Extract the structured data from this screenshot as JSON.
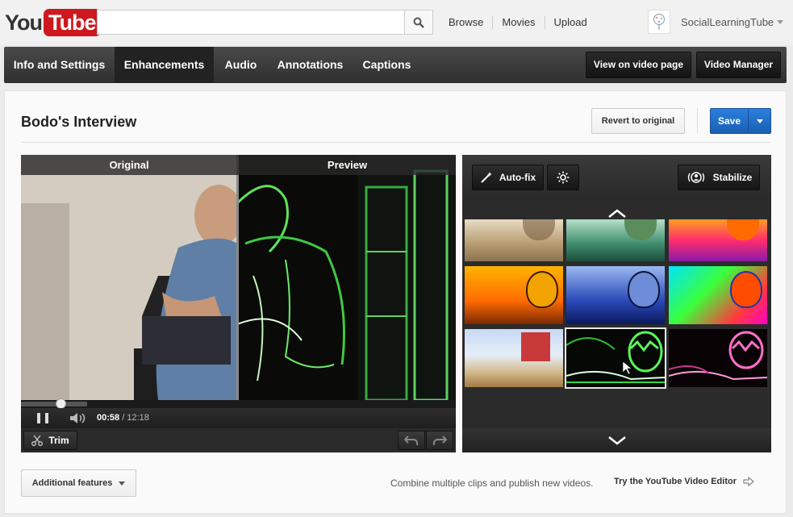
{
  "brand": {
    "you": "You",
    "tube": "Tube"
  },
  "search": {
    "placeholder": ""
  },
  "topnav": {
    "browse": "Browse",
    "movies": "Movies",
    "upload": "Upload"
  },
  "user": {
    "name": "SocialLearningTube"
  },
  "tabs": [
    "Info and Settings",
    "Enhancements",
    "Audio",
    "Annotations",
    "Captions"
  ],
  "active_tab": "Enhancements",
  "header_buttons": {
    "view_on_video_page": "View on video page",
    "video_manager": "Video Manager"
  },
  "editor": {
    "title": "Bodo's Interview",
    "revert_label": "Revert to original",
    "save_label": "Save"
  },
  "video": {
    "original_label": "Original",
    "preview_label": "Preview",
    "current_time": "00:58",
    "separator": " / ",
    "duration": "12:18",
    "trim_label": "Trim",
    "progress_fraction": 0.079
  },
  "effects": {
    "autofix_label": "Auto-fix",
    "stabilize_label": "Stabilize",
    "filters": [
      "faded-sepia",
      "teal-tint",
      "rainbow-fire",
      "orange-sunset",
      "blue-tone",
      "heat-map",
      "pixelate",
      "neon-green",
      "neon-pink"
    ],
    "selected_filter": "neon-green"
  },
  "footer": {
    "additional_features": "Additional features",
    "combine_text": "Combine multiple clips and publish new videos.",
    "try_editor": "Try the YouTube Video Editor"
  },
  "colors": {
    "save_blue": "#1f6ccc",
    "brand_red": "#cc181e",
    "tab_bar": "#3a3a3a"
  }
}
